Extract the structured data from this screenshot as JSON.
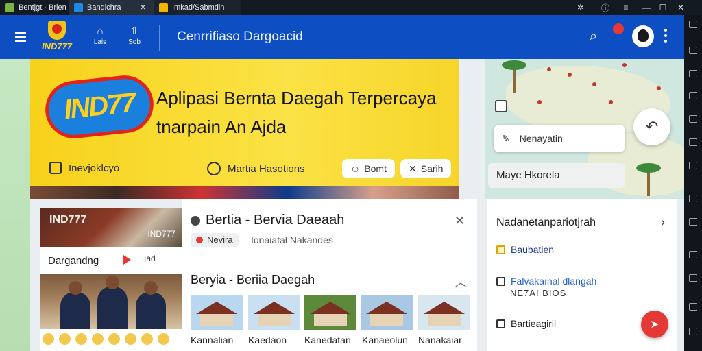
{
  "window": {
    "tabs": [
      {
        "label": "Bentjgt · Brien",
        "icon_color": "#7cb342"
      },
      {
        "label": "Bandichra",
        "icon_color": "#1e88e5"
      },
      {
        "label": "Imkad/Sabmdln",
        "icon_color": "#f2b705"
      }
    ],
    "close_glyph": "✕"
  },
  "header": {
    "brand": "IND777",
    "nav": [
      {
        "label": "Lais",
        "icon": "home-icon"
      },
      {
        "label": "Sob",
        "icon": "upload-icon"
      }
    ],
    "title": "Cenrrifiaso Dargoacid",
    "accent": "#0d4ec2"
  },
  "hero": {
    "logo_text": "IND77",
    "headline": "Aplipasi Bernta Daegah Terpercaya tnarpain An Ajda",
    "link1": "Inevjoklcyo",
    "link2": "Martia Hasotions",
    "pill1": "Bomt",
    "pill2": "Sarih"
  },
  "map": {
    "search": "Nenayatin",
    "label": "Maye Hkorela"
  },
  "left_card": {
    "photo_label": "IND777",
    "photo_caption": "IND777",
    "title": "Dargandng",
    "control": "ıad"
  },
  "article": {
    "title": "Bertia - Bervia Daeaah",
    "tag": "Nevira",
    "meta": "Ionaiatal Nakandes",
    "subtitle": "Beryia - Beriia Daegah",
    "thumbs": [
      "Kannalian",
      "Kaedaon",
      "Kanedatan",
      "Kanaeolun",
      "Nanakaiar"
    ]
  },
  "sidebar": {
    "heading": "Nadanetanpariotjrah",
    "items": [
      {
        "label": "Baubatien",
        "color": "#1f3a8a"
      },
      {
        "label": "Falvakaınal dlangah",
        "color": "#1f5fc9"
      },
      {
        "label": "Bartieagiril",
        "color": "#222222"
      }
    ],
    "sub": "NE7AI BIOS"
  }
}
